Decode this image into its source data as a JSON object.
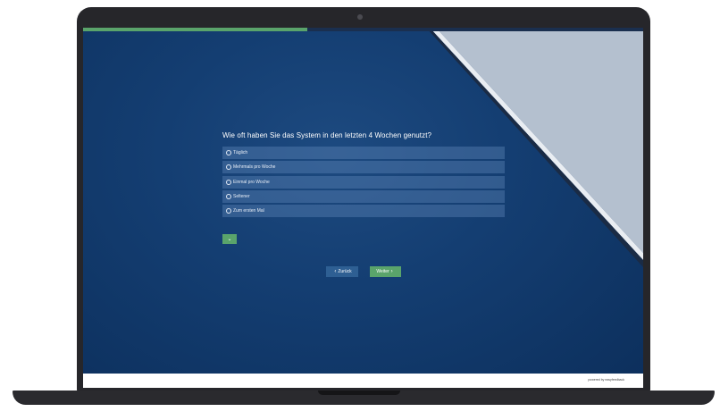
{
  "survey": {
    "progress_fraction": 0.4,
    "question": "Wie oft haben Sie das System in den letzten 4 Wochen genutzt?",
    "options": [
      {
        "label": "Täglich"
      },
      {
        "label": "Mehrmals pro Woche"
      },
      {
        "label": "Einmal pro Woche"
      },
      {
        "label": "Seltener"
      },
      {
        "label": "Zum ersten Mal"
      }
    ],
    "dropdown_icon": "chevron-down-icon",
    "back_label": "Zurück",
    "next_label": "Weiter",
    "back_icon": "chevron-left-icon",
    "next_icon": "chevron-right-icon"
  },
  "footer": {
    "powered_by": "powered by easyfeedback"
  },
  "colors": {
    "background": "#143e72",
    "accent_green": "#5aa46b",
    "option_fill": "#4f78a8",
    "back_button": "#2e5f93",
    "diagonal_panel": "#b4c0cf"
  }
}
